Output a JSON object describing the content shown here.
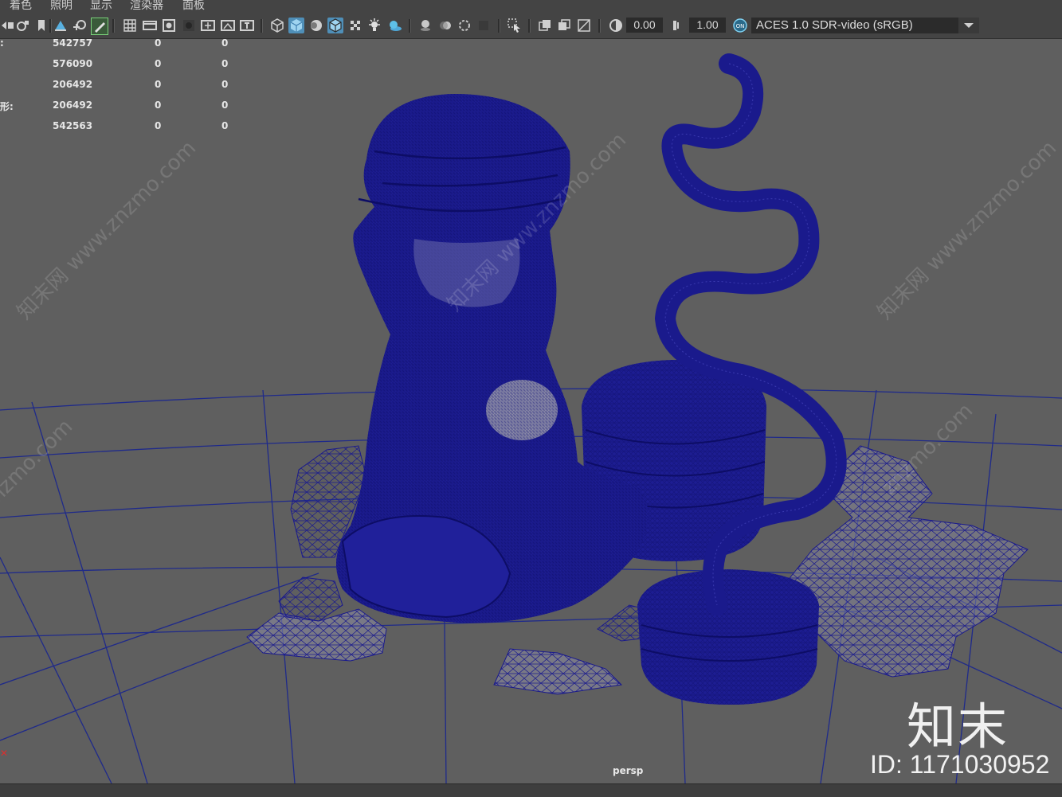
{
  "menu": {
    "items": [
      "着色",
      "照明",
      "显示",
      "渲染器",
      "面板"
    ]
  },
  "toolbar": {
    "exposure_value": "0.00",
    "gamma_value": "1.00",
    "color_management_badge": "ON",
    "colorspace_label": "ACES 1.0 SDR-video (sRGB)"
  },
  "hud": {
    "rows": [
      {
        "label": ":",
        "v1": "542757",
        "v2": "0",
        "v3": "0"
      },
      {
        "label": "",
        "v1": "576090",
        "v2": "0",
        "v3": "0"
      },
      {
        "label": "",
        "v1": "206492",
        "v2": "0",
        "v3": "0"
      },
      {
        "label": "形:",
        "v1": "206492",
        "v2": "0",
        "v3": "0"
      },
      {
        "label": "",
        "v1": "542563",
        "v2": "0",
        "v3": "0"
      }
    ]
  },
  "viewport": {
    "camera_label": "persp",
    "wireframe_color": "#1a1a8c",
    "background_color": "#5f5f5f",
    "grid_color": "#1f2a8a"
  },
  "watermark": {
    "logo_text": "知末",
    "id_text": "ID: 1171030952",
    "diagonal_text": "知末网 www.znzmo.com",
    "diagonal_text_short": "znzmo.com"
  },
  "icons": {
    "toolbar": [
      "camera-select-icon",
      "camera-attributes-icon",
      "bookmark-icon",
      "image-plane-icon",
      "2d-pan-zoom-icon",
      "grease-pencil-icon",
      "grid-icon",
      "film-gate-icon",
      "resolution-gate-icon",
      "gate-mask-icon",
      "field-chart-icon",
      "safe-action-icon",
      "safe-title-icon",
      "wireframe-icon",
      "smooth-shade-icon",
      "default-material-icon",
      "wireframe-on-shaded-icon",
      "xray-icon",
      "use-all-lights-icon",
      "shadows-icon",
      "screen-space-ao-icon",
      "motion-blur-icon",
      "anti-aliasing-icon",
      "depth-of-field-icon",
      "isolate-select-icon",
      "xray-joints-icon",
      "xray-active-icon",
      "backface-culling-icon",
      "exposure-icon",
      "gamma-icon",
      "color-management-icon"
    ]
  }
}
